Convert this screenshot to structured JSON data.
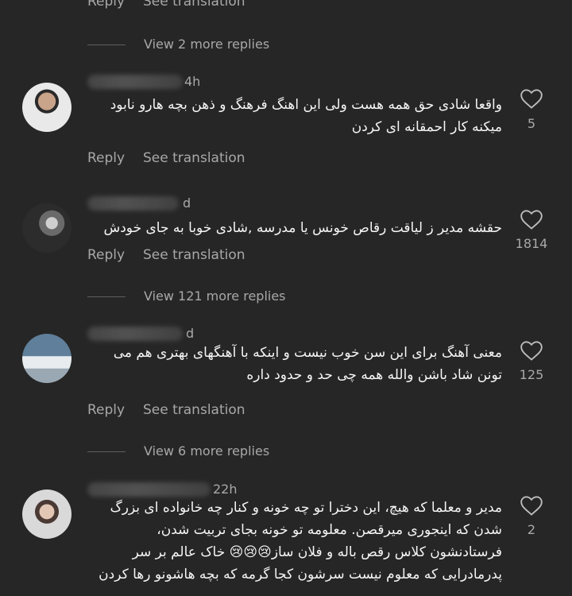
{
  "top": {
    "reply": "Reply",
    "see_translation": "See translation",
    "view_more": "View 2 more replies"
  },
  "comments": [
    {
      "timestamp": "4h",
      "text": "واقعا شادی حق همه هست ولی این اهنگ فرهنگ و ذهن بچه هارو نابود میکنه کار احمقانه ای کردن",
      "likes": "5",
      "reply": "Reply",
      "see_translation": "See translation"
    },
    {
      "timestamp": "d",
      "text": "حقشه مدیر ز لیاقت رقاص خونس یا مدرسه ,شادی خوبا به جای خودش",
      "likes": "1814",
      "reply": "Reply",
      "see_translation": "See translation",
      "view_more": "View 121 more replies"
    },
    {
      "timestamp": "d",
      "text": "معنی آهنگ برای این سن خوب نیست و اینکه با آهنگهای بهتری هم می تونن شاد باشن والله همه چی حد و حدود داره",
      "likes": "125",
      "reply": "Reply",
      "see_translation": "See translation",
      "view_more": "View 6 more replies"
    },
    {
      "timestamp": "22h",
      "text": "مدیر و معلما که هیچ، این دخترا تو چه خونه و کنار چه خانواده ای بزرگ شدن که اینجوری میرقصن. معلومه تو خونه بجای تربیت شدن، فرستادنشون کلاس رقص باله و فلان ساز😢😢😢 خاک عالم بر سر پدرمادرایی که معلوم نیست سرشون کجا گرمه که بچه هاشونو رها کردن",
      "likes": "2"
    }
  ]
}
